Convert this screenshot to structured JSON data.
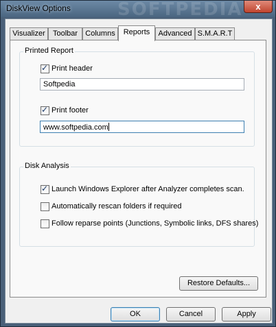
{
  "window": {
    "title": "DiskView Options",
    "watermark": "SOFTPEDIA",
    "close_glyph": "x"
  },
  "tabs": [
    {
      "label": "Visualizer"
    },
    {
      "label": "Toolbar"
    },
    {
      "label": "Columns"
    },
    {
      "label": "Reports",
      "active": true
    },
    {
      "label": "Advanced"
    },
    {
      "label": "S.M.A.R.T"
    }
  ],
  "printed_report": {
    "group_title": "Printed Report",
    "print_header": {
      "label": "Print header",
      "checked": true
    },
    "header_value": "Softpedia",
    "print_footer": {
      "label": "Print footer",
      "checked": true
    },
    "footer_value": "www.softpedia.com"
  },
  "disk_analysis": {
    "group_title": "Disk Analysis",
    "options": [
      {
        "label": "Launch Windows Explorer after Analyzer completes scan.",
        "checked": true
      },
      {
        "label": "Automatically rescan folders if required",
        "checked": false
      },
      {
        "label": "Follow reparse points (Junctions, Symbolic links, DFS shares)",
        "checked": false
      }
    ]
  },
  "buttons": {
    "restore_defaults": "Restore Defaults...",
    "ok": "OK",
    "cancel": "Cancel",
    "apply": "Apply"
  },
  "icons": {
    "check": "checkmark-icon"
  }
}
